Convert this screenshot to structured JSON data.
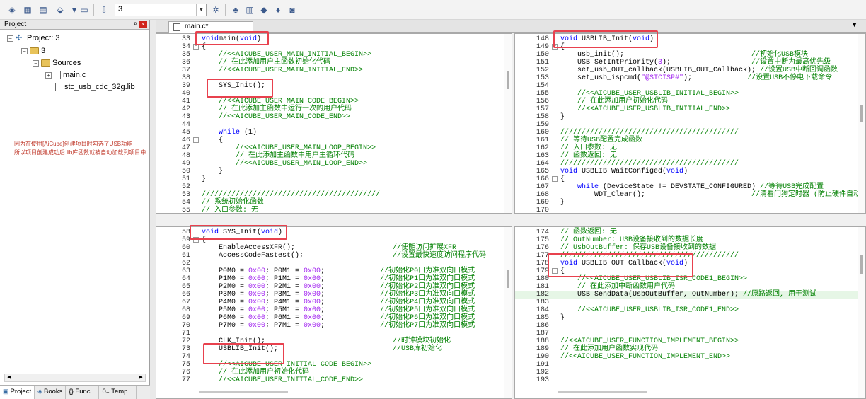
{
  "toolbar": {
    "target_value": "3"
  },
  "project": {
    "title": "Project",
    "pin": "ᵖ",
    "close": "×",
    "root": "Project: 3",
    "target": "3",
    "group": "Sources",
    "files": [
      "main.c",
      "stc_usb_cdc_32g.lib"
    ],
    "note_line1": "因为在使用[AiCube]创建项目时勾选了USB功能",
    "note_line2": "所以项目创建成功后.lib库函数就被自动加载到项目中",
    "tabs": [
      "Project",
      "Books",
      "{} Func...",
      "0₊ Temp..."
    ]
  },
  "editor": {
    "tab_label": "main.c*",
    "dropdown": "▼"
  },
  "panes": [
    {
      "lines": [
        {
          "n": "33",
          "f": "",
          "c": [
            [
              "kw",
              "void"
            ],
            [
              "",
              "main("
            ],
            [
              "kw",
              "void"
            ],
            [
              "",
              ")"
            ]
          ]
        },
        {
          "n": "34",
          "f": "box",
          "c": [
            [
              "",
              "{"
            ]
          ]
        },
        {
          "n": "35",
          "f": "",
          "c": [
            [
              "cm",
              "    //<<AICUBE_USER_MAIN_INITIAL_BEGIN>>"
            ]
          ]
        },
        {
          "n": "36",
          "f": "",
          "c": [
            [
              "cm",
              "    // 在此添加用户主函数初始化代码"
            ]
          ]
        },
        {
          "n": "37",
          "f": "",
          "c": [
            [
              "cm",
              "    //<<AICUBE_USER_MAIN_INITIAL_END>>"
            ]
          ]
        },
        {
          "n": "38",
          "f": "",
          "c": []
        },
        {
          "n": "39",
          "f": "",
          "c": [
            [
              "",
              "    SYS_Init();"
            ]
          ]
        },
        {
          "n": "40",
          "f": "",
          "c": []
        },
        {
          "n": "41",
          "f": "",
          "c": [
            [
              "cm",
              "    //<<AICUBE_USER_MAIN_CODE_BEGIN>>"
            ]
          ]
        },
        {
          "n": "42",
          "f": "",
          "c": [
            [
              "cm",
              "    // 在此添加主函数中运行一次的用户代码"
            ]
          ]
        },
        {
          "n": "43",
          "f": "",
          "c": [
            [
              "cm",
              "    //<<AICUBE_USER_MAIN_CODE_END>>"
            ]
          ]
        },
        {
          "n": "44",
          "f": "",
          "c": []
        },
        {
          "n": "45",
          "f": "",
          "c": [
            [
              "kw",
              "    while"
            ],
            [
              "",
              " (1)"
            ]
          ]
        },
        {
          "n": "46",
          "f": "box",
          "c": [
            [
              "",
              "    {"
            ]
          ]
        },
        {
          "n": "47",
          "f": "",
          "c": [
            [
              "cm",
              "        //<<AICUBE_USER_MAIN_LOOP_BEGIN>>"
            ]
          ]
        },
        {
          "n": "48",
          "f": "",
          "c": [
            [
              "cm",
              "        // 在此添加主函数中用户主循环代码"
            ]
          ]
        },
        {
          "n": "49",
          "f": "",
          "c": [
            [
              "cm",
              "        //<<AICUBE_USER_MAIN_LOOP_END>>"
            ]
          ]
        },
        {
          "n": "50",
          "f": "",
          "c": [
            [
              "",
              "    }"
            ]
          ]
        },
        {
          "n": "51",
          "f": "",
          "c": [
            [
              "",
              "}"
            ]
          ]
        },
        {
          "n": "52",
          "f": "",
          "c": []
        },
        {
          "n": "53",
          "f": "",
          "c": [
            [
              "cm",
              "//////////////////////////////////////////"
            ]
          ]
        },
        {
          "n": "54",
          "f": "",
          "c": [
            [
              "cm",
              "// 系统初始化函数"
            ]
          ]
        },
        {
          "n": "55",
          "f": "",
          "c": [
            [
              "cm",
              "// 入口参数: 无"
            ]
          ]
        }
      ]
    },
    {
      "lines": [
        {
          "n": "148",
          "f": "",
          "c": [
            [
              "kw",
              "void"
            ],
            [
              "",
              " USBLIB_Init("
            ],
            [
              "kw",
              "void"
            ],
            [
              "",
              ")"
            ]
          ]
        },
        {
          "n": "149",
          "f": "box",
          "c": [
            [
              "",
              "{"
            ]
          ]
        },
        {
          "n": "150",
          "f": "",
          "c": [
            [
              "",
              "    usb_init();                              "
            ],
            [
              "cm",
              "//初始化USB模块"
            ]
          ]
        },
        {
          "n": "151",
          "f": "",
          "c": [
            [
              "",
              "    USB_SetIntPriority("
            ],
            [
              "num",
              "3"
            ],
            [
              "",
              "); "
            ],
            [
              "cm",
              "                  //设置中断为最高优先级"
            ]
          ]
        },
        {
          "n": "152",
          "f": "",
          "c": [
            [
              "",
              "    set_usb_OUT_callback(USBLIB_OUT_Callback); "
            ],
            [
              "cm",
              "//设置USB中断回调函数"
            ]
          ]
        },
        {
          "n": "153",
          "f": "",
          "c": [
            [
              "",
              "    set_usb_ispcmd("
            ],
            [
              "str",
              "\"@STCISP#\""
            ],
            [
              "",
              "); "
            ],
            [
              "cm",
              "            //设置USB不停电下载命令"
            ]
          ]
        },
        {
          "n": "154",
          "f": "",
          "c": []
        },
        {
          "n": "155",
          "f": "",
          "c": [
            [
              "cm",
              "    //<<AICUBE_USER_USBLIB_INITIAL_BEGIN>>"
            ]
          ]
        },
        {
          "n": "156",
          "f": "",
          "c": [
            [
              "cm",
              "    // 在此添加用户初始化代码"
            ]
          ]
        },
        {
          "n": "157",
          "f": "",
          "c": [
            [
              "cm",
              "    //<<AICUBE_USER_USBLIB_INITIAL_END>>"
            ]
          ]
        },
        {
          "n": "158",
          "f": "",
          "c": [
            [
              "",
              "}"
            ]
          ]
        },
        {
          "n": "159",
          "f": "",
          "c": []
        },
        {
          "n": "160",
          "f": "",
          "c": [
            [
              "cm",
              "//////////////////////////////////////////"
            ]
          ]
        },
        {
          "n": "161",
          "f": "",
          "c": [
            [
              "cm",
              "// 等待USB配置完成函数"
            ]
          ]
        },
        {
          "n": "162",
          "f": "",
          "c": [
            [
              "cm",
              "// 入口参数: 无"
            ]
          ]
        },
        {
          "n": "163",
          "f": "",
          "c": [
            [
              "cm",
              "// 函数返回: 无"
            ]
          ]
        },
        {
          "n": "164",
          "f": "",
          "c": [
            [
              "cm",
              "//////////////////////////////////////////"
            ]
          ]
        },
        {
          "n": "165",
          "f": "",
          "c": [
            [
              "kw",
              "void"
            ],
            [
              "",
              " USBLIB_WaitConfiged("
            ],
            [
              "kw",
              "void"
            ],
            [
              "",
              ")"
            ]
          ]
        },
        {
          "n": "166",
          "f": "box",
          "c": [
            [
              "",
              "{"
            ]
          ]
        },
        {
          "n": "167",
          "f": "",
          "c": [
            [
              "kw",
              "    while"
            ],
            [
              "",
              " (DeviceState != DEVSTATE_CONFIGURED) "
            ],
            [
              "cm",
              "//等待USB完成配置"
            ]
          ]
        },
        {
          "n": "168",
          "f": "",
          "c": [
            [
              "",
              "        WDT_Clear();                         "
            ],
            [
              "cm",
              "//清看门狗定时器 (防止硬件自动使能"
            ]
          ]
        },
        {
          "n": "169",
          "f": "",
          "c": [
            [
              "",
              "}"
            ]
          ]
        },
        {
          "n": "170",
          "f": "",
          "c": []
        }
      ]
    },
    {
      "lines": [
        {
          "n": "58",
          "f": "",
          "c": [
            [
              "kw",
              "void"
            ],
            [
              "",
              " SYS_Init("
            ],
            [
              "kw",
              "void"
            ],
            [
              "",
              ")"
            ]
          ]
        },
        {
          "n": "59",
          "f": "box",
          "c": [
            [
              "",
              "{"
            ]
          ]
        },
        {
          "n": "60",
          "f": "",
          "c": [
            [
              "",
              "    EnableAccessXFR();                       "
            ],
            [
              "cm",
              "//使能访问扩展XFR"
            ]
          ]
        },
        {
          "n": "61",
          "f": "",
          "c": [
            [
              "",
              "    AccessCodeFastest();                     "
            ],
            [
              "cm",
              "//设置最快速度访问程序代码"
            ]
          ]
        },
        {
          "n": "62",
          "f": "",
          "c": []
        },
        {
          "n": "63",
          "f": "",
          "c": [
            [
              "",
              "    P0M0 = "
            ],
            [
              "num",
              "0x00"
            ],
            [
              "",
              "; P0M1 = "
            ],
            [
              "num",
              "0x00"
            ],
            [
              "",
              ";             "
            ],
            [
              "cm",
              "//初始化P0口为准双向口模式"
            ]
          ]
        },
        {
          "n": "64",
          "f": "",
          "c": [
            [
              "",
              "    P1M0 = "
            ],
            [
              "num",
              "0x00"
            ],
            [
              "",
              "; P1M1 = "
            ],
            [
              "num",
              "0x00"
            ],
            [
              "",
              ";             "
            ],
            [
              "cm",
              "//初始化P1口为准双向口模式"
            ]
          ]
        },
        {
          "n": "65",
          "f": "",
          "c": [
            [
              "",
              "    P2M0 = "
            ],
            [
              "num",
              "0x00"
            ],
            [
              "",
              "; P2M1 = "
            ],
            [
              "num",
              "0x00"
            ],
            [
              "",
              ";             "
            ],
            [
              "cm",
              "//初始化P2口为准双向口模式"
            ]
          ]
        },
        {
          "n": "66",
          "f": "",
          "c": [
            [
              "",
              "    P3M0 = "
            ],
            [
              "num",
              "0x00"
            ],
            [
              "",
              "; P3M1 = "
            ],
            [
              "num",
              "0x00"
            ],
            [
              "",
              ";             "
            ],
            [
              "cm",
              "//初始化P3口为准双向口模式"
            ]
          ]
        },
        {
          "n": "67",
          "f": "",
          "c": [
            [
              "",
              "    P4M0 = "
            ],
            [
              "num",
              "0x00"
            ],
            [
              "",
              "; P4M1 = "
            ],
            [
              "num",
              "0x00"
            ],
            [
              "",
              ";             "
            ],
            [
              "cm",
              "//初始化P4口为准双向口模式"
            ]
          ]
        },
        {
          "n": "68",
          "f": "",
          "c": [
            [
              "",
              "    P5M0 = "
            ],
            [
              "num",
              "0x00"
            ],
            [
              "",
              "; P5M1 = "
            ],
            [
              "num",
              "0x00"
            ],
            [
              "",
              ";             "
            ],
            [
              "cm",
              "//初始化P5口为准双向口模式"
            ]
          ]
        },
        {
          "n": "69",
          "f": "",
          "c": [
            [
              "",
              "    P6M0 = "
            ],
            [
              "num",
              "0x00"
            ],
            [
              "",
              "; P6M1 = "
            ],
            [
              "num",
              "0x00"
            ],
            [
              "",
              ";             "
            ],
            [
              "cm",
              "//初始化P6口为准双向口模式"
            ]
          ]
        },
        {
          "n": "70",
          "f": "",
          "c": [
            [
              "",
              "    P7M0 = "
            ],
            [
              "num",
              "0x00"
            ],
            [
              "",
              "; P7M1 = "
            ],
            [
              "num",
              "0x00"
            ],
            [
              "",
              ";             "
            ],
            [
              "cm",
              "//初始化P7口为准双向口模式"
            ]
          ]
        },
        {
          "n": "71",
          "f": "",
          "c": []
        },
        {
          "n": "72",
          "f": "",
          "c": [
            [
              "",
              "    CLK_Init();                              "
            ],
            [
              "cm",
              "//时钟模块初始化"
            ]
          ]
        },
        {
          "n": "73",
          "f": "",
          "c": [
            [
              "",
              "    USBLIB_Init();                           "
            ],
            [
              "cm",
              "//USB库初始化"
            ]
          ]
        },
        {
          "n": "74",
          "f": "",
          "c": []
        },
        {
          "n": "75",
          "f": "",
          "c": [
            [
              "cm",
              "    //<<AICUBE_USER_INITIAL_CODE_BEGIN>>"
            ]
          ]
        },
        {
          "n": "76",
          "f": "",
          "c": [
            [
              "cm",
              "    // 在此添加用户初始化代码"
            ]
          ]
        },
        {
          "n": "77",
          "f": "",
          "c": [
            [
              "cm",
              "    //<<AICUBE_USER_INITIAL_CODE_END>>"
            ]
          ]
        }
      ]
    },
    {
      "lines": [
        {
          "n": "174",
          "f": "",
          "c": [
            [
              "cm",
              "// 函数返回: 无"
            ]
          ]
        },
        {
          "n": "175",
          "f": "",
          "c": [
            [
              "cm",
              "// OutNumber: USB设备接收到的数据长度"
            ]
          ]
        },
        {
          "n": "176",
          "f": "",
          "c": [
            [
              "cm",
              "// UsbOutBuffer: 保存USB设备接收到的数据"
            ]
          ]
        },
        {
          "n": "177",
          "f": "",
          "c": [
            [
              "cm",
              "//////////////////////////////////////////"
            ]
          ]
        },
        {
          "n": "178",
          "f": "",
          "c": [
            [
              "kw",
              "void"
            ],
            [
              "",
              " USBLIB_OUT_Callback("
            ],
            [
              "kw",
              "void"
            ],
            [
              "",
              ")"
            ]
          ]
        },
        {
          "n": "179",
          "f": "box",
          "c": [
            [
              "",
              "{"
            ]
          ]
        },
        {
          "n": "180",
          "f": "",
          "c": [
            [
              "cm",
              "    //<<AICUBE_USER_USBLIB_ISR_CODE1_BEGIN>>"
            ]
          ]
        },
        {
          "n": "181",
          "f": "",
          "c": [
            [
              "cm",
              "    // 在此添加中断函数用户代码"
            ]
          ]
        },
        {
          "n": "182",
          "f": "",
          "hl": true,
          "c": [
            [
              "",
              "    USB_SendData(UsbOutBuffer, OutNumber); "
            ],
            [
              "cm",
              "//原路返回, 用于测试"
            ]
          ]
        },
        {
          "n": "183",
          "f": "",
          "c": []
        },
        {
          "n": "184",
          "f": "",
          "c": [
            [
              "cm",
              "    //<<AICUBE_USER_USBLIB_ISR_CODE1_END>>"
            ]
          ]
        },
        {
          "n": "185",
          "f": "",
          "c": [
            [
              "",
              "}"
            ]
          ]
        },
        {
          "n": "186",
          "f": "",
          "c": []
        },
        {
          "n": "187",
          "f": "",
          "c": []
        },
        {
          "n": "188",
          "f": "",
          "c": [
            [
              "cm",
              "//<<AICUBE_USER_FUNCTION_IMPLEMENT_BEGIN>>"
            ]
          ]
        },
        {
          "n": "189",
          "f": "",
          "c": [
            [
              "cm",
              "// 在此添加用户函数实现代码"
            ]
          ]
        },
        {
          "n": "190",
          "f": "",
          "c": [
            [
              "cm",
              "//<<AICUBE_USER_FUNCTION_IMPLEMENT_END>>"
            ]
          ]
        },
        {
          "n": "191",
          "f": "",
          "c": []
        },
        {
          "n": "192",
          "f": "",
          "c": []
        },
        {
          "n": "193",
          "f": "",
          "c": []
        }
      ]
    }
  ]
}
